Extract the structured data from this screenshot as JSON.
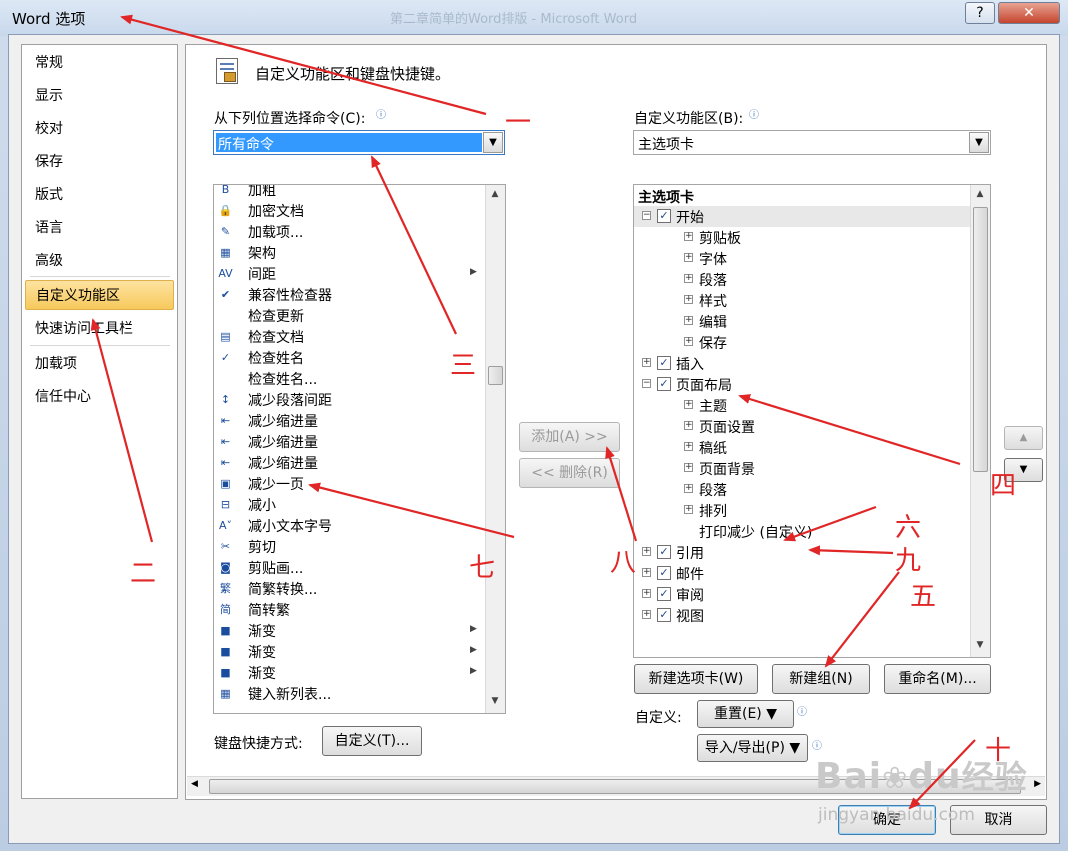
{
  "window": {
    "title": "Word 选项",
    "background_title": "第二章简单的Word排版 - Microsoft Word",
    "help": "?",
    "close": "✕"
  },
  "nav": {
    "items": [
      "常规",
      "显示",
      "校对",
      "保存",
      "版式",
      "语言",
      "高级",
      "自定义功能区",
      "快速访问工具栏",
      "加载项",
      "信任中心"
    ],
    "selected": "自定义功能区"
  },
  "header": {
    "title": "自定义功能区和键盘快捷键。"
  },
  "left": {
    "label": "从下列位置选择命令(C):",
    "combo_value": "所有命令",
    "commands": [
      {
        "icon": "bold-icon",
        "glyph": "B",
        "label": "加粗",
        "sub": false
      },
      {
        "icon": "lock-doc-icon",
        "glyph": "🔒",
        "label": "加密文档",
        "sub": false
      },
      {
        "icon": "addin-icon",
        "glyph": "✎",
        "label": "加载项...",
        "sub": false
      },
      {
        "icon": "building-block-icon",
        "glyph": "▦",
        "label": "架构",
        "sub": false
      },
      {
        "icon": "spacing-icon",
        "glyph": "AV",
        "label": "间距",
        "sub": true
      },
      {
        "icon": "compat-check-icon",
        "glyph": "✔",
        "label": "兼容性检查器",
        "sub": false
      },
      {
        "icon": "blank-icon",
        "glyph": "",
        "label": "检查更新",
        "sub": false
      },
      {
        "icon": "inspect-doc-icon",
        "glyph": "▤",
        "label": "检查文档",
        "sub": false
      },
      {
        "icon": "check-names-icon",
        "glyph": "✓",
        "label": "检查姓名",
        "sub": false
      },
      {
        "icon": "blank-icon",
        "glyph": "",
        "label": "检查姓名...",
        "sub": false
      },
      {
        "icon": "decrease-spacing-icon",
        "glyph": "↕",
        "label": "减少段落间距",
        "sub": false
      },
      {
        "icon": "decrease-indent-icon",
        "glyph": "⇤",
        "label": "减少缩进量",
        "sub": false
      },
      {
        "icon": "decrease-indent-icon",
        "glyph": "⇤",
        "label": "减少缩进量",
        "sub": false
      },
      {
        "icon": "decrease-indent-icon",
        "glyph": "⇤",
        "label": "减少缩进量",
        "sub": false
      },
      {
        "icon": "shrink-page-icon",
        "glyph": "▣",
        "label": "减少一页",
        "sub": false
      },
      {
        "icon": "shrink-icon",
        "glyph": "⊟",
        "label": "减小",
        "sub": false
      },
      {
        "icon": "shrink-font-icon",
        "glyph": "A˅",
        "label": "减小文本字号",
        "sub": false
      },
      {
        "icon": "scissors-icon",
        "glyph": "✂",
        "label": "剪切",
        "sub": false
      },
      {
        "icon": "clipart-icon",
        "glyph": "◙",
        "label": "剪贴画...",
        "sub": false
      },
      {
        "icon": "trad-to-simp-icon",
        "glyph": "繁",
        "label": "简繁转换...",
        "sub": false
      },
      {
        "icon": "simp-to-trad-icon",
        "glyph": "简",
        "label": "简转繁",
        "sub": false
      },
      {
        "icon": "gradient-icon",
        "glyph": "■",
        "label": "渐变",
        "sub": true
      },
      {
        "icon": "gradient-icon",
        "glyph": "■",
        "label": "渐变",
        "sub": true
      },
      {
        "icon": "gradient-icon",
        "glyph": "■",
        "label": "渐变",
        "sub": true
      },
      {
        "icon": "new-list-icon",
        "glyph": "▦",
        "label": "键入新列表...",
        "sub": false
      }
    ],
    "shortcut_label": "键盘快捷方式:",
    "shortcut_button": "自定义(T)..."
  },
  "middle": {
    "add_button": "添加(A) >>",
    "remove_button": "<< 删除(R)"
  },
  "right": {
    "label": "自定义功能区(B):",
    "combo_value": "主选项卡",
    "tree_header": "主选项卡",
    "tree": [
      {
        "level": 0,
        "pm": "⊟",
        "checked": true,
        "label": "开始"
      },
      {
        "level": 1,
        "pm": "⊞",
        "label": "剪贴板"
      },
      {
        "level": 1,
        "pm": "⊞",
        "label": "字体"
      },
      {
        "level": 1,
        "pm": "⊞",
        "label": "段落"
      },
      {
        "level": 1,
        "pm": "⊞",
        "label": "样式"
      },
      {
        "level": 1,
        "pm": "⊞",
        "label": "编辑"
      },
      {
        "level": 1,
        "pm": "⊞",
        "label": "保存"
      },
      {
        "level": 0,
        "pm": "⊞",
        "checked": true,
        "label": "插入"
      },
      {
        "level": 0,
        "pm": "⊟",
        "checked": true,
        "label": "页面布局"
      },
      {
        "level": 1,
        "pm": "⊞",
        "label": "主题"
      },
      {
        "level": 1,
        "pm": "⊞",
        "label": "页面设置"
      },
      {
        "level": 1,
        "pm": "⊞",
        "label": "稿纸"
      },
      {
        "level": 1,
        "pm": "⊞",
        "label": "页面背景"
      },
      {
        "level": 1,
        "pm": "⊞",
        "label": "段落"
      },
      {
        "level": 1,
        "pm": "⊞",
        "label": "排列"
      },
      {
        "level": 1,
        "pm": "",
        "label": "打印减少 (自定义)"
      },
      {
        "level": 0,
        "pm": "⊞",
        "checked": true,
        "label": "引用"
      },
      {
        "level": 0,
        "pm": "⊞",
        "checked": true,
        "label": "邮件"
      },
      {
        "level": 0,
        "pm": "⊞",
        "checked": true,
        "label": "审阅"
      },
      {
        "level": 0,
        "pm": "⊞",
        "checked": true,
        "label": "视图"
      }
    ],
    "new_tab_button": "新建选项卡(W)",
    "new_group_button": "新建组(N)",
    "rename_button": "重命名(M)...",
    "customize_label": "自定义:",
    "reset_button": "重置(E) ▼",
    "import_export_button": "导入/导出(P) ▼"
  },
  "footer": {
    "ok": "确定",
    "cancel": "取消"
  },
  "annotations": [
    "一",
    "二",
    "三",
    "四",
    "五",
    "六",
    "七",
    "八",
    "九",
    "十"
  ],
  "watermark": {
    "brand": "Bai",
    "brand2": "du",
    "brand_cn": "经验",
    "url": "jingyan.baidu.com"
  },
  "colors": {
    "selection": "#3399ff",
    "nav_selected": "#f7c95c",
    "annotation": "#e02626"
  }
}
